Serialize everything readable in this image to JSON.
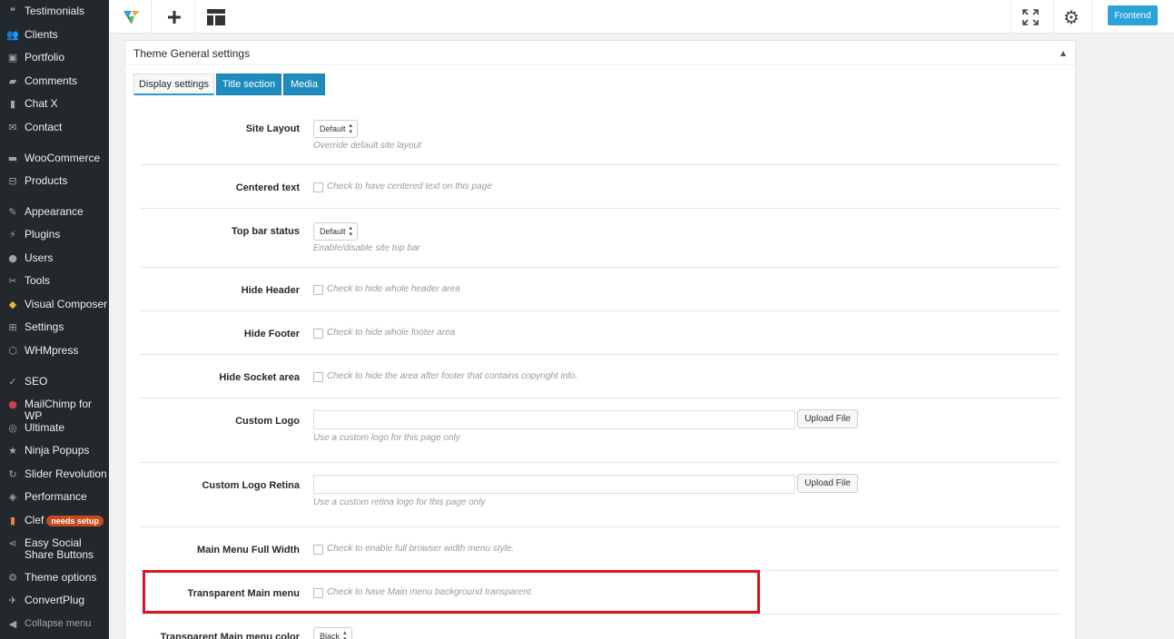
{
  "sidebar": {
    "items": [
      {
        "label": "Testimonials",
        "icon": "quote-icon",
        "glyph": "❝"
      },
      {
        "label": "Clients",
        "icon": "clients-icon",
        "glyph": "👥"
      },
      {
        "label": "Portfolio",
        "icon": "portfolio-icon",
        "glyph": "▣"
      },
      {
        "label": "Comments",
        "icon": "comments-icon",
        "glyph": "▰"
      },
      {
        "label": "Chat X",
        "icon": "chat-icon",
        "glyph": "▮"
      },
      {
        "label": "Contact",
        "icon": "mail-icon",
        "glyph": "✉"
      },
      {
        "label": "WooCommerce",
        "icon": "woocommerce-icon",
        "glyph": "▬"
      },
      {
        "label": "Products",
        "icon": "products-icon",
        "glyph": "⊟"
      },
      {
        "label": "Appearance",
        "icon": "appearance-icon",
        "glyph": "✎"
      },
      {
        "label": "Plugins",
        "icon": "plugins-icon",
        "glyph": "⚡"
      },
      {
        "label": "Users",
        "icon": "users-icon",
        "glyph": "●"
      },
      {
        "label": "Tools",
        "icon": "tools-icon",
        "glyph": "✂"
      },
      {
        "label": "Visual Composer",
        "icon": "visual-composer-icon",
        "glyph": "◆"
      },
      {
        "label": "Settings",
        "icon": "settings-icon",
        "glyph": "⊞"
      },
      {
        "label": "WHMpress",
        "icon": "whmpress-icon",
        "glyph": "⬡"
      },
      {
        "label": "SEO",
        "icon": "seo-icon",
        "glyph": "✓"
      },
      {
        "label": "MailChimp for WP",
        "icon": "mailchimp-icon",
        "glyph": "●"
      },
      {
        "label": "Ultimate",
        "icon": "ultimate-icon",
        "glyph": "◎"
      },
      {
        "label": "Ninja Popups",
        "icon": "star-icon",
        "glyph": "★"
      },
      {
        "label": "Slider Revolution",
        "icon": "slider-icon",
        "glyph": "↻"
      },
      {
        "label": "Performance",
        "icon": "performance-icon",
        "glyph": "◈"
      },
      {
        "label": "Clef",
        "icon": "clef-icon",
        "glyph": "▮",
        "badge": "needs setup"
      },
      {
        "label": "Easy Social Share Buttons",
        "icon": "share-icon",
        "glyph": "⋖"
      },
      {
        "label": "Theme options",
        "icon": "gear-icon",
        "glyph": "⚙"
      },
      {
        "label": "ConvertPlug",
        "icon": "convertplug-icon",
        "glyph": "✈"
      }
    ],
    "collapse_label": "Collapse menu"
  },
  "toolbar": {
    "frontend_label": "Frontend"
  },
  "panel": {
    "title": "Theme General settings",
    "tabs": [
      {
        "label": "Display settings"
      },
      {
        "label": "Title section"
      },
      {
        "label": "Media"
      }
    ],
    "rows": {
      "site_layout": {
        "label": "Site Layout",
        "value": "Default",
        "hint": "Override default site layout"
      },
      "centered_text": {
        "label": "Centered text",
        "hint": "Check to have centered text on this page"
      },
      "top_bar": {
        "label": "Top bar status",
        "value": "Default",
        "hint": "Enable/disable site top bar"
      },
      "hide_header": {
        "label": "Hide Header",
        "hint": "Check to hide whole header area"
      },
      "hide_footer": {
        "label": "Hide Footer",
        "hint": "Check to hide whole footer area"
      },
      "hide_socket": {
        "label": "Hide Socket area",
        "hint": "Check to hide the area after footer that contains copyright info."
      },
      "custom_logo": {
        "label": "Custom Logo",
        "button": "Upload File",
        "hint": "Use a custom logo for this page only"
      },
      "custom_logo_retina": {
        "label": "Custom Logo Retina",
        "button": "Upload File",
        "hint": "Use a custom retina logo for this page only"
      },
      "menu_full_width": {
        "label": "Main Menu Full Width",
        "hint": "Check to enable full browser width menu style."
      },
      "transparent_menu": {
        "label": "Transparent Main menu",
        "hint": "Check to have Main menu background transparent."
      },
      "transparent_menu_color": {
        "label": "Transparent Main menu color",
        "value": "Black"
      }
    }
  },
  "colors": {
    "highlight": "#d9141f",
    "tab_blue": "#1e8cbe",
    "frontend": "#2aa3d8",
    "sidebar_bg": "#23282d"
  }
}
